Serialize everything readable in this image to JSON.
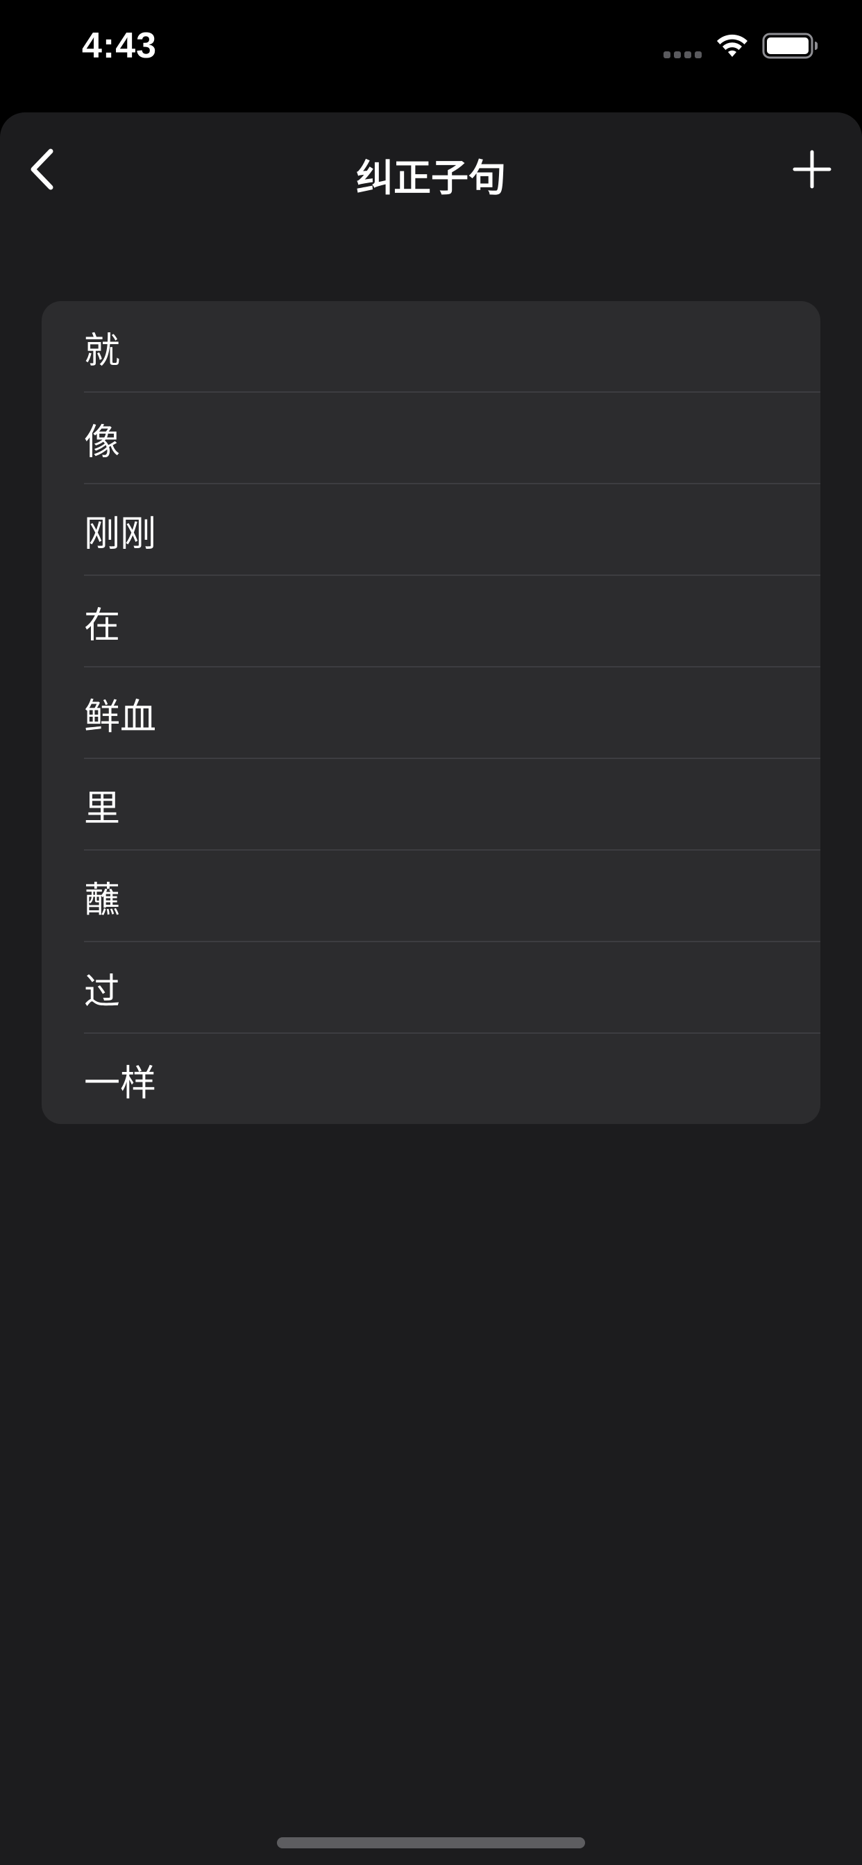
{
  "status_bar": {
    "time": "4:43"
  },
  "nav": {
    "title": "纠正子句",
    "back_icon": "chevron-left-icon",
    "add_icon": "plus-icon"
  },
  "word_list": {
    "items": [
      {
        "label": "就"
      },
      {
        "label": "像"
      },
      {
        "label": "刚刚"
      },
      {
        "label": "在"
      },
      {
        "label": "鲜血"
      },
      {
        "label": "里"
      },
      {
        "label": "蘸"
      },
      {
        "label": "过"
      },
      {
        "label": "一样"
      }
    ]
  },
  "colors": {
    "background": "#000000",
    "sheet": "#1c1c1e",
    "list_background": "#2c2c2e",
    "separator": "#3d3d41",
    "text": "#ffffff"
  }
}
